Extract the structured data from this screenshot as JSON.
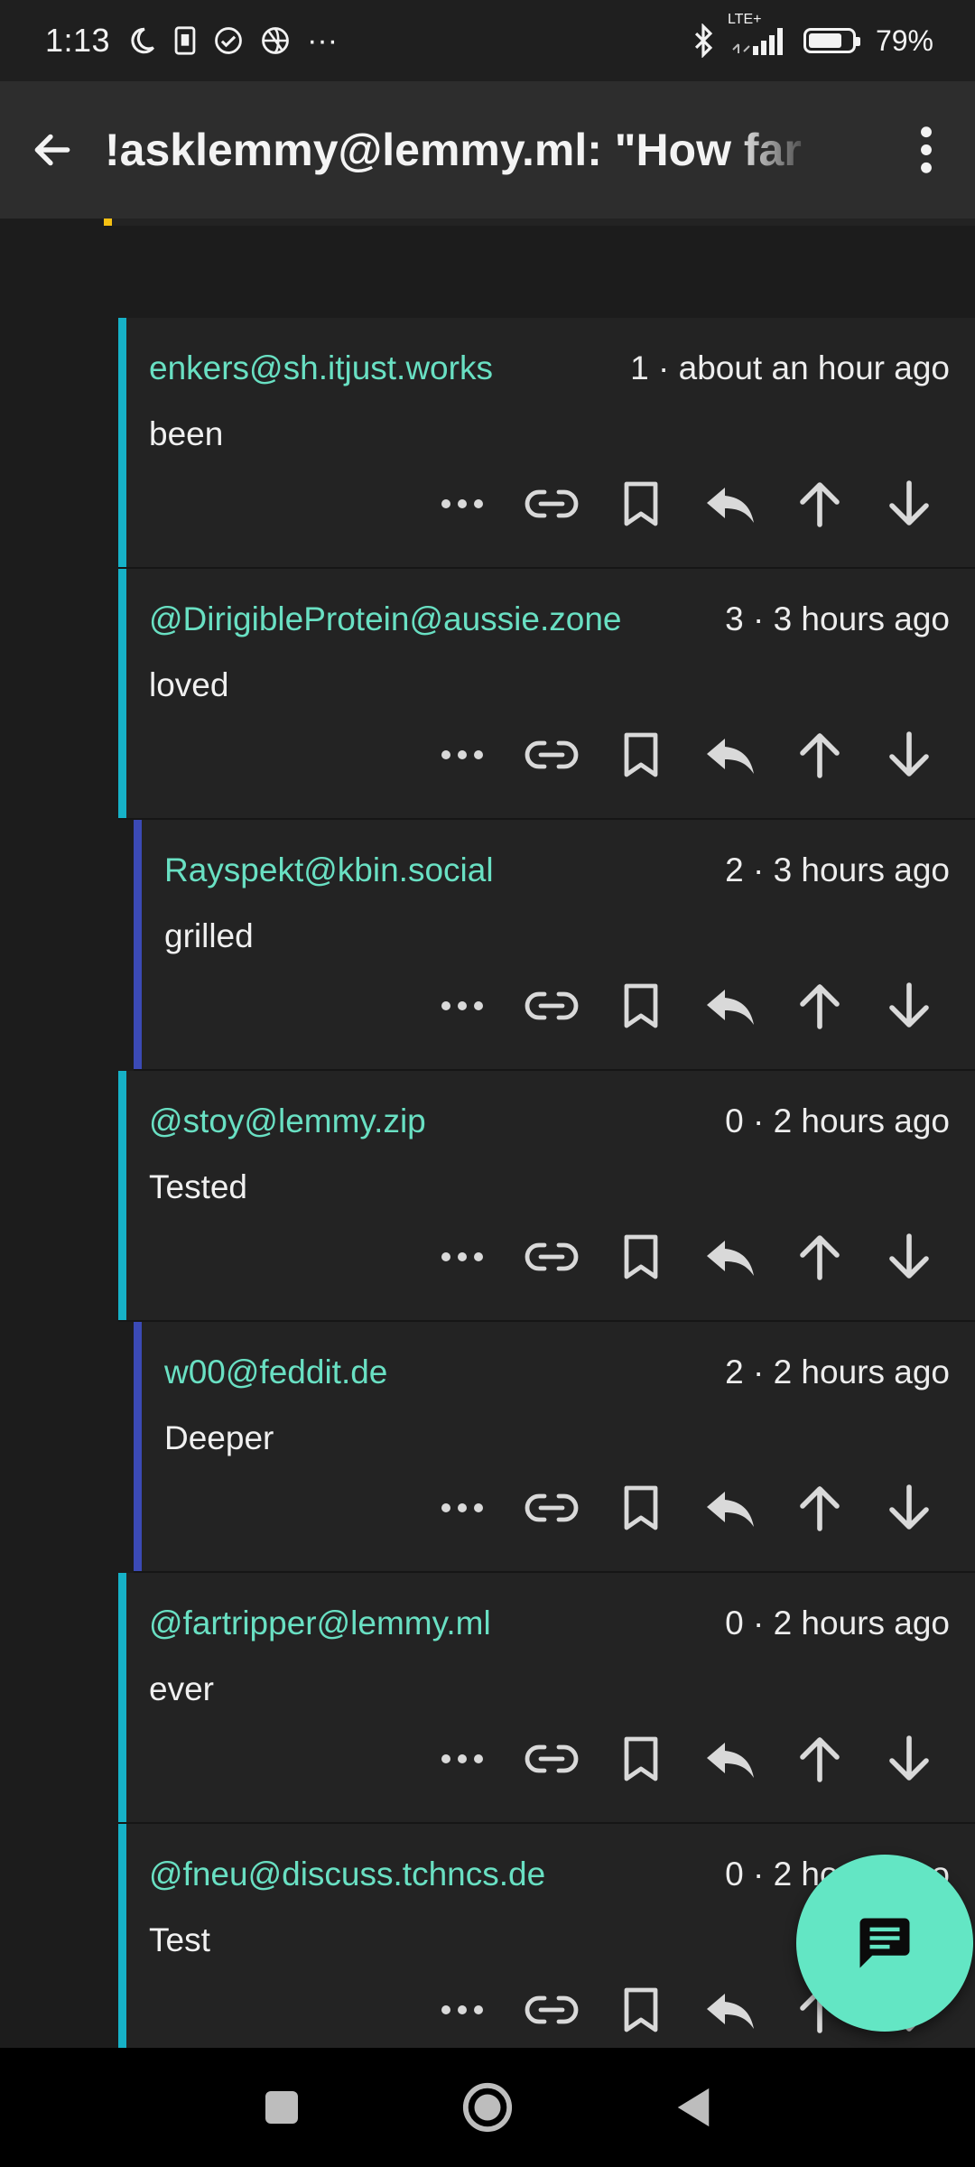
{
  "status_bar": {
    "time": "1:13",
    "network": "LTE+",
    "battery": "79%",
    "battery_level": 0.79,
    "icons": [
      "moon-icon",
      "sim-icon",
      "check-circle-icon",
      "vpn-icon",
      "more-dots-icon",
      "bluetooth-icon",
      "signal-icon",
      "battery-icon"
    ],
    "more": "···"
  },
  "app_bar": {
    "title": "!asklemmy@lemmy.ml: \"How far",
    "back_icon": "arrow-back-icon",
    "menu_icon": "more-vert-icon"
  },
  "action_icons": [
    "more-horiz-icon",
    "link-icon",
    "bookmark-icon",
    "reply-icon",
    "upvote-icon",
    "downvote-icon"
  ],
  "top_partial_comment": {
    "bar_color": "#f5c012"
  },
  "comments": [
    {
      "author": "enkers@sh.itjust.works",
      "meta": "1 · about an hour ago",
      "body": "been",
      "bar_color": "#16b1c7"
    },
    {
      "author": "@DirigibleProtein@aussie.zone",
      "meta": "3 · 3 hours ago",
      "body": "loved",
      "bar_color": "#16b1c7"
    },
    {
      "author": "Rayspekt@kbin.social",
      "meta": "2 · 3 hours ago",
      "body": "grilled",
      "bar_color": "#3b4ab5"
    },
    {
      "author": "@stoy@lemmy.zip",
      "meta": "0 · 2 hours ago",
      "body": "Tested",
      "bar_color": "#16b1c7"
    },
    {
      "author": "w00@feddit.de",
      "meta": "2 · 2 hours ago",
      "body": "Deeper",
      "bar_color": "#3b4ab5"
    },
    {
      "author": "@fartripper@lemmy.ml",
      "meta": "0 · 2 hours ago",
      "body": "ever",
      "bar_color": "#16b1c7"
    },
    {
      "author": "@fneu@discuss.tchncs.de",
      "meta": "0 · 2 hours ago",
      "body": "Test",
      "bar_color": "#16b1c7"
    }
  ],
  "fab": {
    "icon": "comment-icon",
    "color": "#63e6c4"
  },
  "nav_bar": {
    "icons": [
      "recents-square-icon",
      "home-circle-icon",
      "back-triangle-icon"
    ]
  }
}
